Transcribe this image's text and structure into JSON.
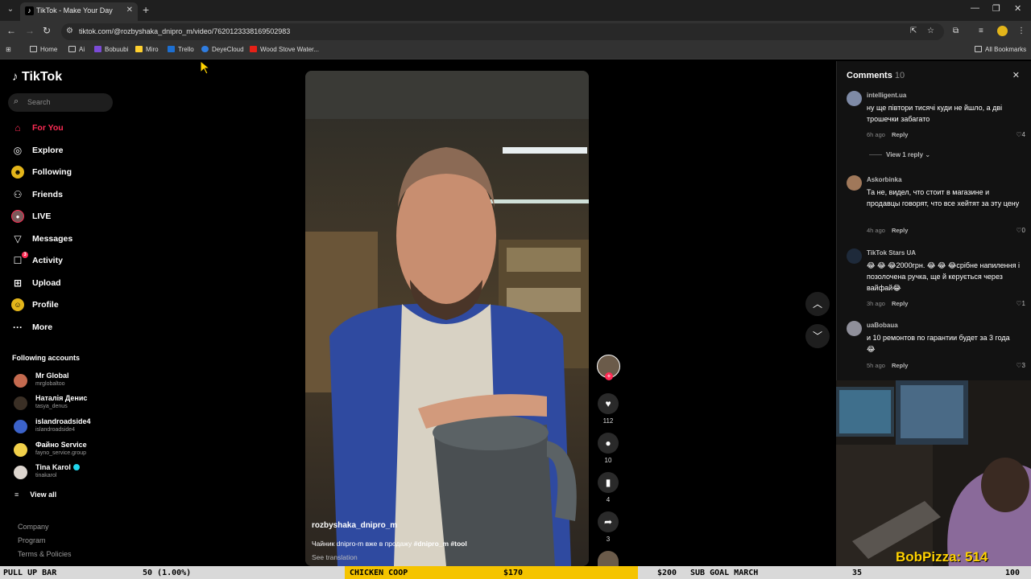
{
  "browser": {
    "tab_title": "TikTok - Make Your Day",
    "url": "tiktok.com/@rozbyshaka_dnipro_m/video/7620123338169502983",
    "bookmarks": [
      {
        "label": "Home",
        "color": "#cccccc"
      },
      {
        "label": "Ai",
        "color": "#cccccc"
      },
      {
        "label": "Bobuubi",
        "color": "#7b4bd6"
      },
      {
        "label": "Miro",
        "color": "#ffd02f"
      },
      {
        "label": "Trello",
        "color": "#1d6fd1"
      },
      {
        "label": "DeyeCloud",
        "color": "#2f7de1"
      },
      {
        "label": "Wood Stove Water...",
        "color": "#e62117"
      }
    ],
    "all_bookmarks": "All Bookmarks"
  },
  "sidebar": {
    "logo": "TikTok",
    "search_placeholder": "Search",
    "nav": [
      {
        "label": "For You",
        "icon": "home-icon"
      },
      {
        "label": "Explore",
        "icon": "compass-icon"
      },
      {
        "label": "Following",
        "icon": "following-icon"
      },
      {
        "label": "Friends",
        "icon": "friends-icon"
      },
      {
        "label": "LIVE",
        "icon": "live-icon"
      },
      {
        "label": "Messages",
        "icon": "messages-icon"
      },
      {
        "label": "Activity",
        "icon": "activity-icon",
        "badge": "3"
      },
      {
        "label": "Upload",
        "icon": "upload-icon"
      },
      {
        "label": "Profile",
        "icon": "profile-icon"
      },
      {
        "label": "More",
        "icon": "more-icon"
      }
    ],
    "following_title": "Following accounts",
    "accounts": [
      {
        "name": "Mr Global",
        "handle": "mrglobaltoo",
        "color": "#c46a4f"
      },
      {
        "name": "Наталія Денис",
        "handle": "tasya_denus",
        "color": "#3a2f25"
      },
      {
        "name": "islandroadside4",
        "handle": "islandroadside4",
        "color": "#3b62c9"
      },
      {
        "name": "Файно Service",
        "handle": "fayno_service.group",
        "color": "#f1d04a"
      },
      {
        "name": "Tina Karol",
        "handle": "tinakarol",
        "color": "#ddd6cf",
        "verified": true
      }
    ],
    "view_all": "View all",
    "footer": [
      "Company",
      "Program",
      "Terms & Policies"
    ]
  },
  "video": {
    "username": "rozbyshaka_dnipro_m",
    "description": "Чайник dnipro-m вже в продажу",
    "hashtags": "#dnipro_m #tool",
    "see_translation": "See translation",
    "likes": "112",
    "comments": "10",
    "saves": "4",
    "shares": "3"
  },
  "comments_panel": {
    "title": "Comments",
    "count": "10",
    "view_reply": "View 1 reply",
    "reply_label": "Reply",
    "items": [
      {
        "user": "intelligent.ua",
        "text": "ну ще півтори тисячі куди не йшло, а дві трошечки забагато",
        "time": "6h ago",
        "likes": "4",
        "color": "#7e8aa6"
      },
      {
        "user": "Askorbinka",
        "text": "Та не, видел, что стоит в магазине и продавцы говорят, что все хейтят за эту цену",
        "time": "4h ago",
        "likes": "0",
        "color": "#a0785a"
      },
      {
        "user": "TikTok Stars UA",
        "text": "😂 😂 😂2000грн. 😂 😂 😂срібне напилення і позолочена ручка, ще й керується через вайфай😂",
        "time": "3h ago",
        "likes": "1",
        "color": "#1e2a3a"
      },
      {
        "user": "uaBobaua",
        "text": "и 10 ремонтов по гарантии будет за 3 года 😂",
        "time": "5h ago",
        "likes": "3",
        "color": "#8f8f9a"
      }
    ]
  },
  "stream": {
    "name": "BobPizza: 514"
  },
  "ticker": {
    "items": [
      "PULL UP BAR",
      "50 (1.00%)",
      "CHICKEN COOP",
      "$170",
      "$200",
      "SUB GOAL MARCH",
      "35",
      "100"
    ]
  }
}
